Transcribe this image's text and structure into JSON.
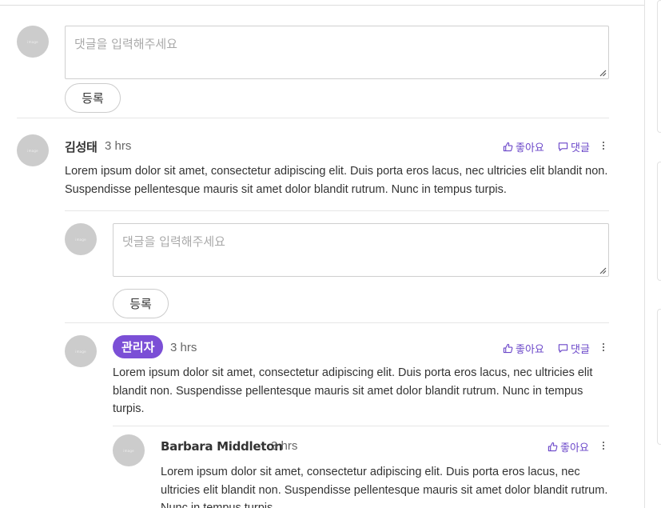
{
  "new_comment": {
    "placeholder": "댓글을 입력해주세요",
    "submit_label": "등록"
  },
  "comments": [
    {
      "author": "김성태",
      "time": "3 hrs",
      "like_label": "좋아요",
      "reply_label": "댓글",
      "text": "Lorem ipsum dolor sit amet, consectetur adipiscing elit. Duis porta eros lacus, nec ultricies elit blandit non. Suspendisse pellentesque mauris sit amet dolor blandit rutrum. Nunc in tempus turpis.",
      "reply_form": {
        "placeholder": "댓글을 입력해주세요",
        "submit_label": "등록"
      },
      "replies": [
        {
          "author_badge": "관리자",
          "time": "3 hrs",
          "like_label": "좋아요",
          "reply_label": "댓글",
          "text": "Lorem ipsum dolor sit amet, consectetur adipiscing elit. Duis porta eros lacus, nec ultricies elit blandit non. Suspendisse pellentesque mauris sit amet dolor blandit rutrum. Nunc in tempus turpis.",
          "replies": [
            {
              "author": "Barbara Middleton",
              "time": "3 hrs",
              "like_label": "좋아요",
              "text": "Lorem ipsum dolor sit amet, consectetur adipiscing elit. Duis porta eros lacus, nec ultricies elit blandit non. Suspendisse pellentesque mauris sit amet dolor blandit rutrum. Nunc in tempus turpis."
            }
          ]
        }
      ]
    }
  ],
  "avatar_text": "image",
  "colors": {
    "accent": "#6b47c9",
    "badge": "#7b4fd6",
    "avatar": "#cccccc",
    "border": "#cfcfcf"
  },
  "icons": {
    "like": "thumbs-up-icon",
    "reply": "speech-bubble-icon",
    "more": "vertical-ellipsis-icon",
    "resize": "resize-grip-icon"
  }
}
